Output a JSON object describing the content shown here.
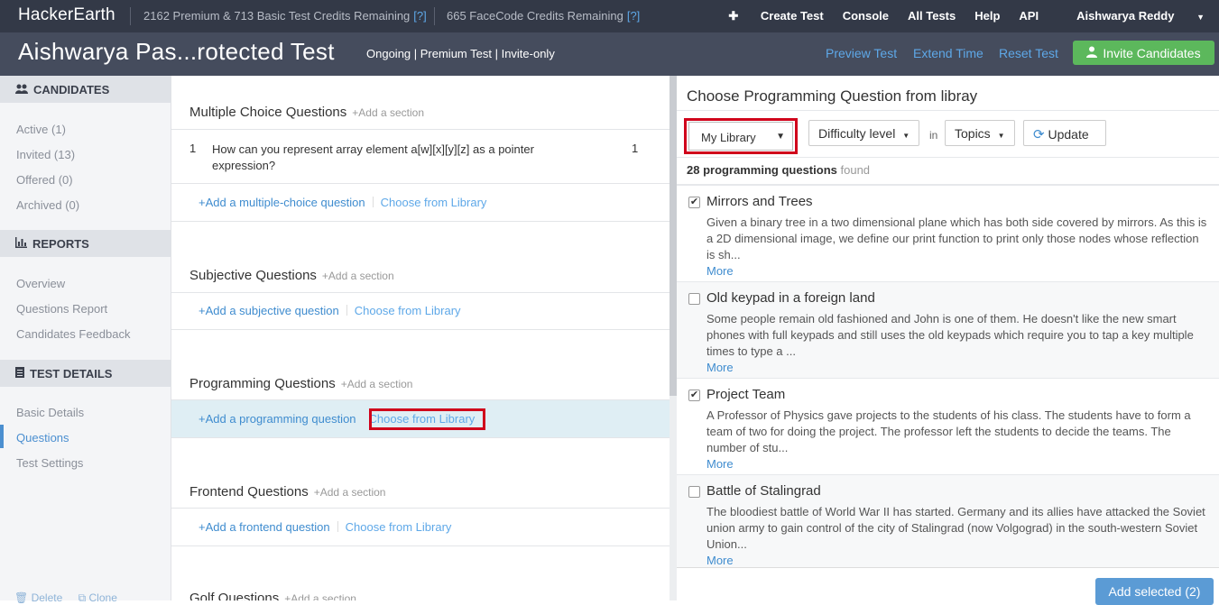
{
  "topbar": {
    "logo": "HackerEarth",
    "credits1": "2162 Premium & 713 Basic Test Credits Remaining",
    "credits2": "665 FaceCode Credits Remaining",
    "help_mark": "[?]",
    "nav": {
      "create": "Create Test",
      "console": "Console",
      "all_tests": "All Tests",
      "help": "Help",
      "api": "API",
      "user": "Aishwarya Reddy"
    }
  },
  "header": {
    "title": "Aishwarya Pas...rotected Test",
    "meta": "Ongoing | Premium Test | Invite-only",
    "preview": "Preview Test",
    "extend": "Extend Time",
    "reset": "Reset Test",
    "invite": "Invite Candidates"
  },
  "sidebar": {
    "candidates_head": "CANDIDATES",
    "candidates": [
      "Active (1)",
      "Invited (13)",
      "Offered (0)",
      "Archived (0)"
    ],
    "reports_head": "REPORTS",
    "reports": [
      "Overview",
      "Questions Report",
      "Candidates Feedback"
    ],
    "details_head": "TEST DETAILS",
    "details": [
      "Basic Details",
      "Questions",
      "Test Settings"
    ],
    "delete": "Delete",
    "clone": "Clone"
  },
  "middle": {
    "add_section": "+Add a section",
    "choose_lib": "Choose from Library",
    "mcq": {
      "title": "Multiple Choice Questions",
      "num": "1",
      "text": "How can you represent array element a[w][x][y][z] as a pointer expression?",
      "score": "1",
      "add": "+Add a multiple-choice question"
    },
    "subjective": {
      "title": "Subjective Questions",
      "add": "+Add a subjective question"
    },
    "programming": {
      "title": "Programming Questions",
      "add": "+Add a programming question"
    },
    "frontend": {
      "title": "Frontend Questions",
      "add": "+Add a frontend question"
    },
    "golf": {
      "title": "Golf Questions"
    }
  },
  "right": {
    "title": "Choose Programming Question from libray",
    "library_select": "My Library",
    "difficulty": "Difficulty level",
    "in_label": "in",
    "topics": "Topics",
    "update": "Update",
    "count_bold": "28 programming questions",
    "count_rest": "found",
    "more": "More",
    "questions": [
      {
        "name": "Mirrors and Trees",
        "checked": true,
        "desc": "Given a binary tree in a two dimensional plane which has both side covered by mirrors. As this is a 2D dimensional image, we define our print function to print only those nodes whose reflection is sh..."
      },
      {
        "name": "Old keypad in a foreign land",
        "checked": false,
        "desc": "Some people remain old fashioned and John is one of them. He doesn't like the new smart phones with full keypads and still uses the old keypads which require you to tap a key multiple times to type a ..."
      },
      {
        "name": "Project Team",
        "checked": true,
        "desc": "A Professor of Physics gave projects to the students of his class. The students have to form a team of two for doing the project. The professor left the students to decide the teams. The number of stu..."
      },
      {
        "name": "Battle of Stalingrad",
        "checked": false,
        "desc": "The bloodiest battle of World War II has started. Germany and its allies have attacked the Soviet union army to gain control of the city of Stalingrad (now Volgograd) in the south-western Soviet Union..."
      }
    ],
    "add_selected": "Add selected (2)"
  }
}
